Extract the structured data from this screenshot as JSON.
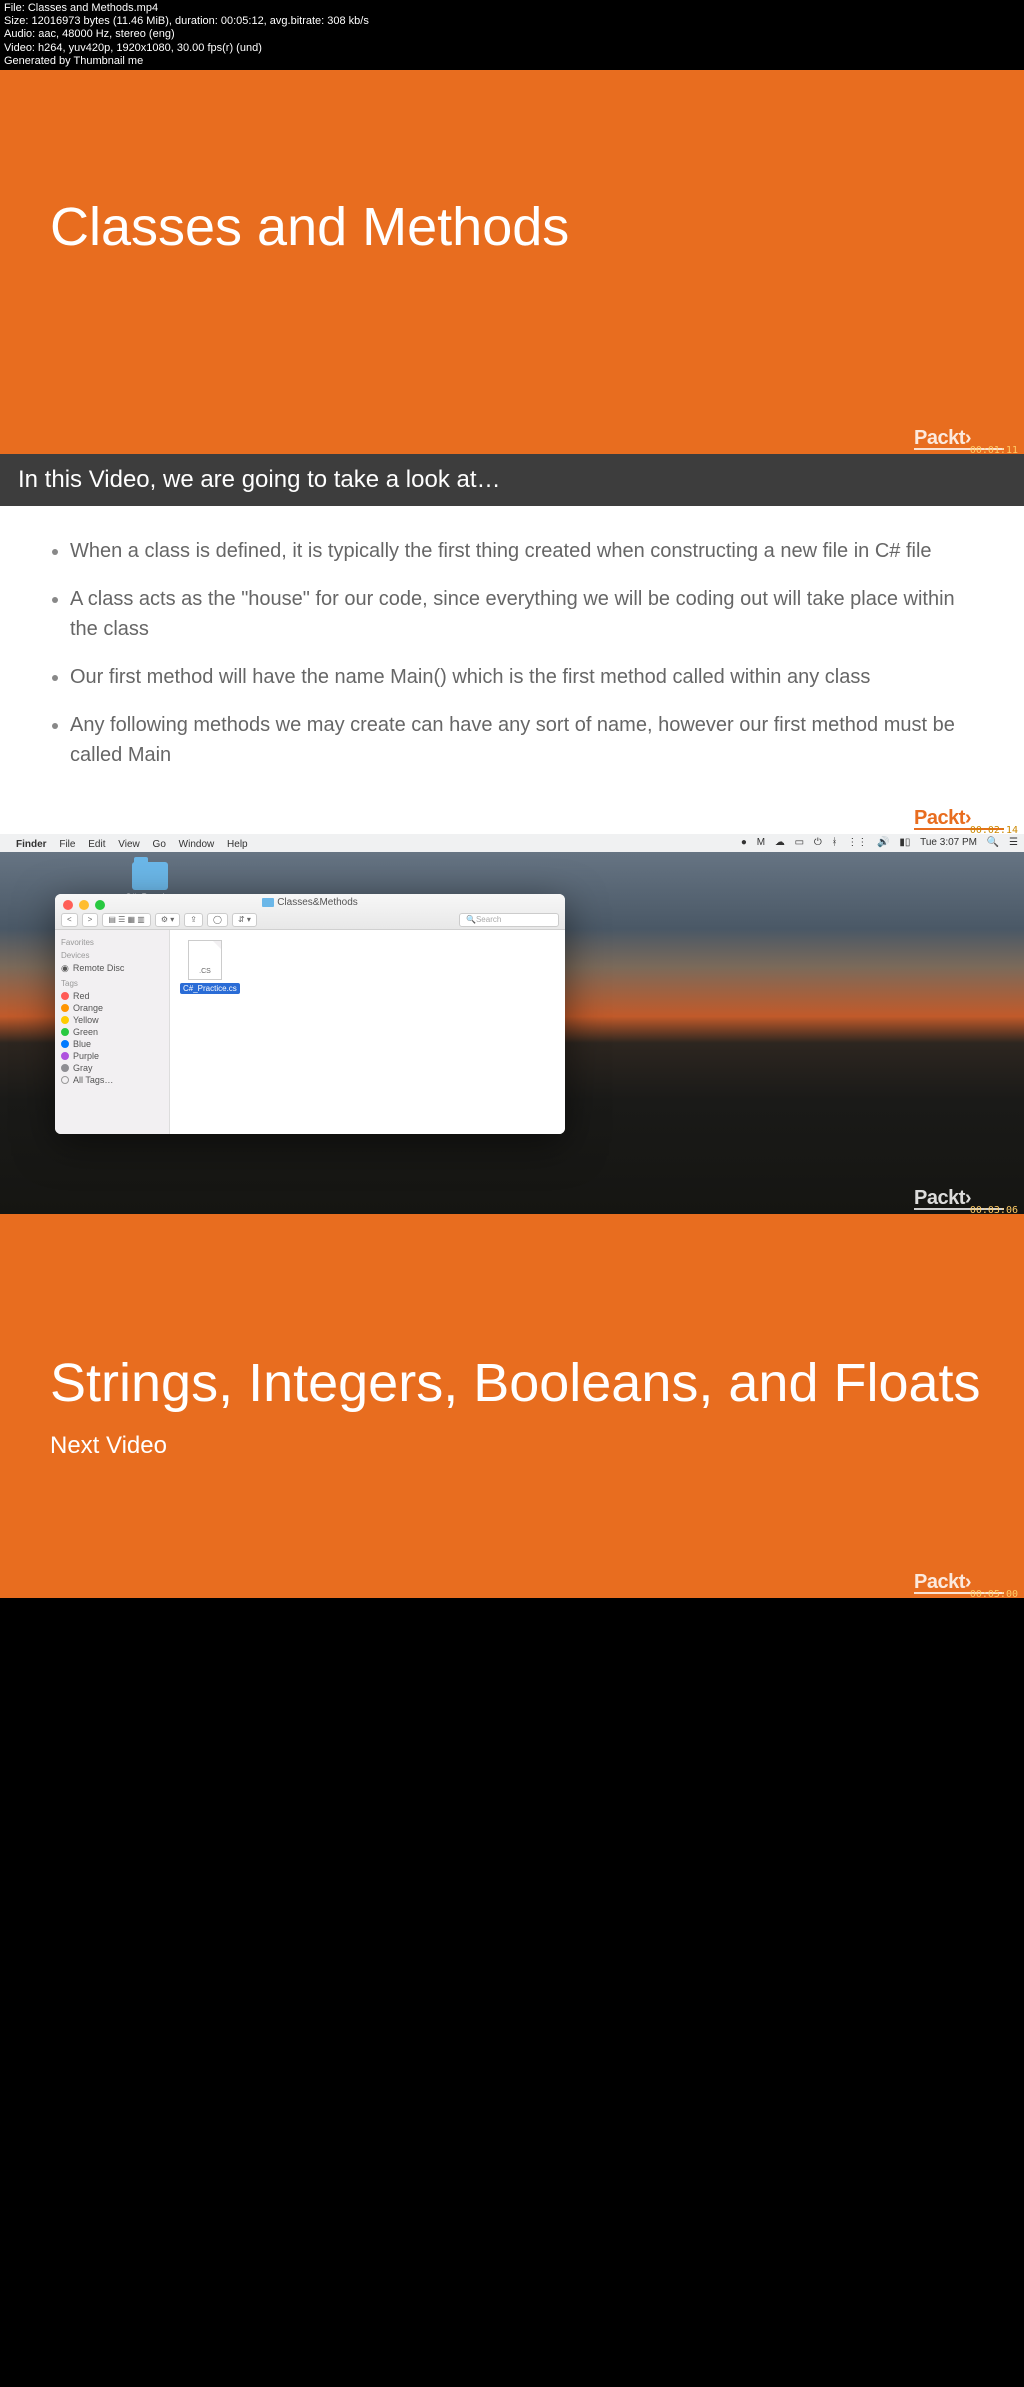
{
  "meta": {
    "l1": "File: Classes and Methods.mp4",
    "l2": "Size: 12016973 bytes (11.46 MiB), duration: 00:05:12, avg.bitrate: 308 kb/s",
    "l3": "Audio: aac, 48000 Hz, stereo (eng)",
    "l4": "Video: h264, yuv420p, 1920x1080, 30.00 fps(r) (und)",
    "l5": "Generated by Thumbnail me"
  },
  "brand": "Packt",
  "frame1": {
    "title": "Classes and Methods",
    "time": "00:01:11"
  },
  "frame2": {
    "bar": "In this Video, we are going to take a look at…",
    "bullets": [
      "When a class is defined, it is typically the first thing created when constructing a new file in C# file",
      "A class acts as the \"house\" for our code, since everything we will be coding out will take place within the class",
      "Our first method will have the name Main() which is the first method called within any class",
      "Any following methods we may create can have any sort of name, however our first method must be called Main"
    ],
    "time": "00:02:14"
  },
  "frame3": {
    "menubar_left": [
      "Finder",
      "File",
      "Edit",
      "View",
      "Go",
      "Window",
      "Help"
    ],
    "menubar_right": "Tue 3:07 PM",
    "desktop_folder": "C#_Practice",
    "finder_title": "Classes&Methods",
    "search_placeholder": "Search",
    "nav_back": "<",
    "nav_fwd": ">",
    "view_icons": "▤ ☰ ▦ ▥",
    "arrange": "⚙ ▾",
    "share": "⇪",
    "tag_btn": "◯",
    "dropbox": "⇵ ▾",
    "sidebar": {
      "favorites": "Favorites",
      "devices": "Devices",
      "remote": "Remote Disc",
      "tags": "Tags",
      "tag_list": [
        {
          "name": "Red",
          "color": "#ff5b56"
        },
        {
          "name": "Orange",
          "color": "#ff9500"
        },
        {
          "name": "Yellow",
          "color": "#ffcc00"
        },
        {
          "name": "Green",
          "color": "#28c940"
        },
        {
          "name": "Blue",
          "color": "#007aff"
        },
        {
          "name": "Purple",
          "color": "#af52de"
        },
        {
          "name": "Gray",
          "color": "#8e8e93"
        }
      ],
      "all_tags": "All Tags…"
    },
    "file_ext": ".CS",
    "file_name": "C#_Practice.cs",
    "time": "00:03:06"
  },
  "frame4": {
    "title": "Strings, Integers, Booleans, and Floats",
    "sub": "Next Video",
    "time": "00:05:00"
  }
}
